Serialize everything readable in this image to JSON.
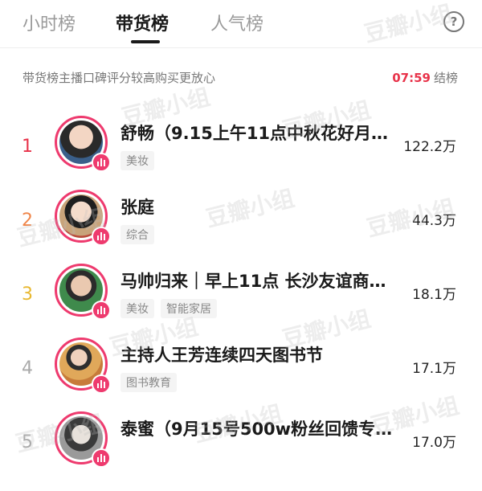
{
  "tabs": [
    {
      "label": "小时榜",
      "active": false
    },
    {
      "label": "带货榜",
      "active": true
    },
    {
      "label": "人气榜",
      "active": false
    }
  ],
  "help_label": "?",
  "notice": "带货榜主播口碑评分较高购买更放心",
  "countdown": {
    "time": "07:59",
    "suffix": "结榜"
  },
  "accent_color": "#ee3a6e",
  "watermark_text": "豆瓣小组",
  "rows": [
    {
      "rank": "1",
      "name": "舒畅（9.15上午11点中秋花好月圆…",
      "tags": [
        "美妆"
      ],
      "count": "122.2万"
    },
    {
      "rank": "2",
      "name": "张庭",
      "tags": [
        "综合"
      ],
      "count": "44.3万"
    },
    {
      "rank": "3",
      "name": "马帅归来｜早上11点 长沙友谊商店…",
      "tags": [
        "美妆",
        "智能家居"
      ],
      "count": "18.1万"
    },
    {
      "rank": "4",
      "name": "主持人王芳连续四天图书节",
      "tags": [
        "图书教育"
      ],
      "count": "17.1万"
    },
    {
      "rank": "5",
      "name": "泰蜜（9月15号500w粉丝回馈专场…",
      "tags": [],
      "count": "17.0万"
    }
  ]
}
